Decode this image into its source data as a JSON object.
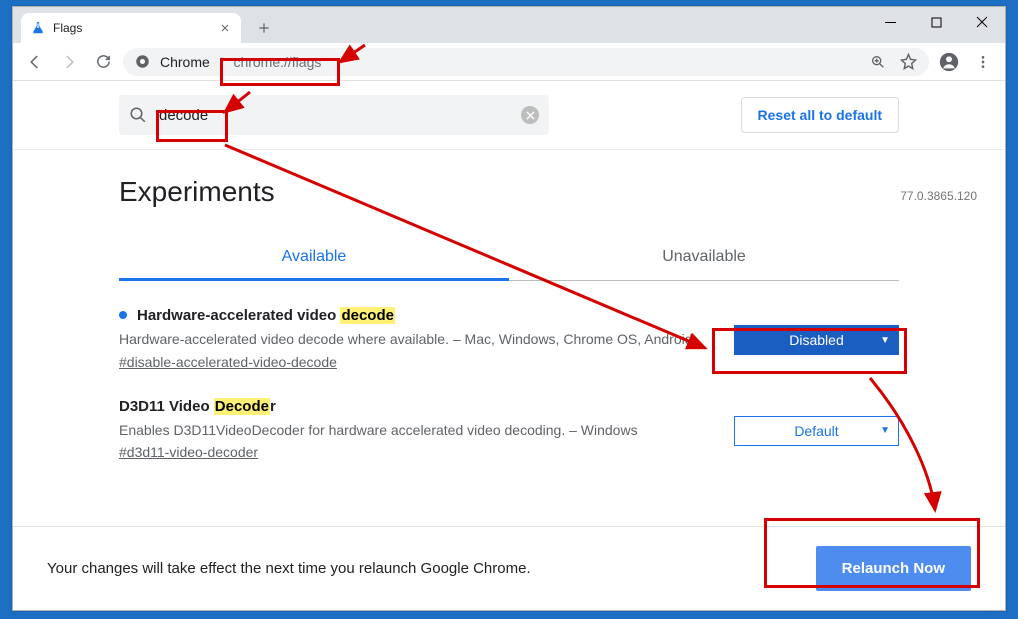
{
  "window": {
    "tab_title": "Flags"
  },
  "omnibox": {
    "label": "Chrome",
    "url": "chrome://flags"
  },
  "search": {
    "value": "decode",
    "reset_label": "Reset all to default"
  },
  "header": {
    "title": "Experiments",
    "version": "77.0.3865.120"
  },
  "tabs": {
    "available": "Available",
    "unavailable": "Unavailable"
  },
  "flags": [
    {
      "title_pre": "Hardware-accelerated video ",
      "title_hl": "decode",
      "title_post": "",
      "desc": "Hardware-accelerated video decode where available. – Mac, Windows, Chrome OS, Android",
      "anchor": "#disable-accelerated-video-decode",
      "select": "Disabled",
      "modified": true
    },
    {
      "title_pre": "D3D11 Video ",
      "title_hl": "Decode",
      "title_post": "r",
      "desc": "Enables D3D11VideoDecoder for hardware accelerated video decoding. – Windows",
      "anchor": "#d3d11-video-decoder",
      "select": "Default",
      "modified": false
    }
  ],
  "bottom": {
    "msg": "Your changes will take effect the next time you relaunch Google Chrome.",
    "relaunch": "Relaunch Now"
  }
}
